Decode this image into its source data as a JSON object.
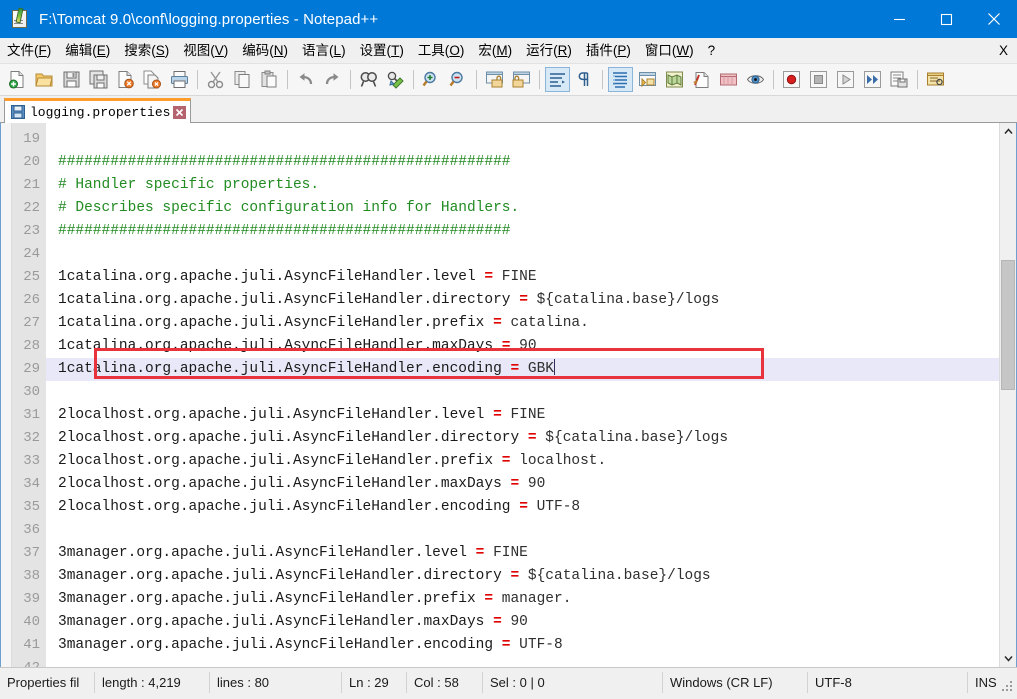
{
  "window": {
    "title": "F:\\Tomcat 9.0\\conf\\logging.properties - Notepad++",
    "icon": "notepad-plus-plus-icon",
    "controls": {
      "minimize": "minimize-icon",
      "maximize": "maximize-icon",
      "close": "close-icon"
    },
    "titlebar_color": "#0078d7"
  },
  "menu": {
    "items": [
      {
        "label": "文件",
        "accel": "F"
      },
      {
        "label": "编辑",
        "accel": "E"
      },
      {
        "label": "搜索",
        "accel": "S"
      },
      {
        "label": "视图",
        "accel": "V"
      },
      {
        "label": "编码",
        "accel": "N"
      },
      {
        "label": "语言",
        "accel": "L"
      },
      {
        "label": "设置",
        "accel": "T"
      },
      {
        "label": "工具",
        "accel": "O"
      },
      {
        "label": "宏",
        "accel": "M"
      },
      {
        "label": "运行",
        "accel": "R"
      },
      {
        "label": "插件",
        "accel": "P"
      },
      {
        "label": "窗口",
        "accel": "W"
      },
      {
        "label": "?",
        "accel": ""
      }
    ],
    "close_document_label": "X"
  },
  "toolbar": {
    "groups": [
      [
        "new-file-icon",
        "open-file-icon",
        "save-icon",
        "save-all-icon",
        "close-file-icon",
        "close-all-files-icon",
        "print-icon"
      ],
      [
        "cut-icon",
        "copy-icon",
        "paste-icon"
      ],
      [
        "undo-icon",
        "redo-icon"
      ],
      [
        "find-icon",
        "replace-icon"
      ],
      [
        "zoom-in-icon",
        "zoom-out-icon"
      ],
      [
        "sync-vertical-scroll-icon",
        "sync-horizontal-scroll-icon"
      ],
      [
        "word-wrap-icon",
        "show-all-characters-icon"
      ],
      [
        "indent-guideline-icon",
        "user-defined-dialog-icon",
        "show-document-map-icon",
        "function-list-icon",
        "folder-as-workspace-icon",
        "monitoring-icon"
      ],
      [
        "macro-record-icon",
        "macro-stop-icon",
        "macro-play-icon",
        "macro-play-multiple-icon",
        "macro-save-icon"
      ],
      [
        "document-list-icon"
      ]
    ],
    "active": [
      "word-wrap-icon",
      "indent-guideline-icon"
    ]
  },
  "tab": {
    "label": "logging.properties",
    "save_icon": "saved-document-icon",
    "close_icon": "tab-close-icon"
  },
  "editor": {
    "first_visible_line": 19,
    "current_line": 29,
    "cursor_after": "GBK",
    "lines": [
      {
        "n": 19,
        "tokens": []
      },
      {
        "n": 20,
        "tokens": [
          {
            "t": "comment",
            "s": "####################################################"
          }
        ]
      },
      {
        "n": 21,
        "tokens": [
          {
            "t": "comment",
            "s": "# Handler specific properties."
          }
        ]
      },
      {
        "n": 22,
        "tokens": [
          {
            "t": "comment",
            "s": "# Describes specific configuration info for Handlers."
          }
        ]
      },
      {
        "n": 23,
        "tokens": [
          {
            "t": "comment",
            "s": "####################################################"
          }
        ]
      },
      {
        "n": 24,
        "tokens": []
      },
      {
        "n": 25,
        "tokens": [
          {
            "t": "key",
            "s": "1catalina.org.apache.juli.AsyncFileHandler.level "
          },
          {
            "t": "eq",
            "s": "="
          },
          {
            "t": "val",
            "s": " FINE"
          }
        ]
      },
      {
        "n": 26,
        "tokens": [
          {
            "t": "key",
            "s": "1catalina.org.apache.juli.AsyncFileHandler.directory "
          },
          {
            "t": "eq",
            "s": "="
          },
          {
            "t": "val",
            "s": " ${catalina.base}/logs"
          }
        ]
      },
      {
        "n": 27,
        "tokens": [
          {
            "t": "key",
            "s": "1catalina.org.apache.juli.AsyncFileHandler.prefix "
          },
          {
            "t": "eq",
            "s": "="
          },
          {
            "t": "val",
            "s": " catalina."
          }
        ]
      },
      {
        "n": 28,
        "tokens": [
          {
            "t": "key",
            "s": "1catalina.org.apache.juli.AsyncFileHandler.maxDays "
          },
          {
            "t": "eq",
            "s": "="
          },
          {
            "t": "val",
            "s": " 90"
          }
        ]
      },
      {
        "n": 29,
        "tokens": [
          {
            "t": "key",
            "s": "1catalina.org.apache.juli.AsyncFileHandler.encoding "
          },
          {
            "t": "eq",
            "s": "="
          },
          {
            "t": "val",
            "s": " GBK"
          }
        ]
      },
      {
        "n": 30,
        "tokens": []
      },
      {
        "n": 31,
        "tokens": [
          {
            "t": "key",
            "s": "2localhost.org.apache.juli.AsyncFileHandler.level "
          },
          {
            "t": "eq",
            "s": "="
          },
          {
            "t": "val",
            "s": " FINE"
          }
        ]
      },
      {
        "n": 32,
        "tokens": [
          {
            "t": "key",
            "s": "2localhost.org.apache.juli.AsyncFileHandler.directory "
          },
          {
            "t": "eq",
            "s": "="
          },
          {
            "t": "val",
            "s": " ${catalina.base}/logs"
          }
        ]
      },
      {
        "n": 33,
        "tokens": [
          {
            "t": "key",
            "s": "2localhost.org.apache.juli.AsyncFileHandler.prefix "
          },
          {
            "t": "eq",
            "s": "="
          },
          {
            "t": "val",
            "s": " localhost."
          }
        ]
      },
      {
        "n": 34,
        "tokens": [
          {
            "t": "key",
            "s": "2localhost.org.apache.juli.AsyncFileHandler.maxDays "
          },
          {
            "t": "eq",
            "s": "="
          },
          {
            "t": "val",
            "s": " 90"
          }
        ]
      },
      {
        "n": 35,
        "tokens": [
          {
            "t": "key",
            "s": "2localhost.org.apache.juli.AsyncFileHandler.encoding "
          },
          {
            "t": "eq",
            "s": "="
          },
          {
            "t": "val",
            "s": " UTF-8"
          }
        ]
      },
      {
        "n": 36,
        "tokens": []
      },
      {
        "n": 37,
        "tokens": [
          {
            "t": "key",
            "s": "3manager.org.apache.juli.AsyncFileHandler.level "
          },
          {
            "t": "eq",
            "s": "="
          },
          {
            "t": "val",
            "s": " FINE"
          }
        ]
      },
      {
        "n": 38,
        "tokens": [
          {
            "t": "key",
            "s": "3manager.org.apache.juli.AsyncFileHandler.directory "
          },
          {
            "t": "eq",
            "s": "="
          },
          {
            "t": "val",
            "s": " ${catalina.base}/logs"
          }
        ]
      },
      {
        "n": 39,
        "tokens": [
          {
            "t": "key",
            "s": "3manager.org.apache.juli.AsyncFileHandler.prefix "
          },
          {
            "t": "eq",
            "s": "="
          },
          {
            "t": "val",
            "s": " manager."
          }
        ]
      },
      {
        "n": 40,
        "tokens": [
          {
            "t": "key",
            "s": "3manager.org.apache.juli.AsyncFileHandler.maxDays "
          },
          {
            "t": "eq",
            "s": "="
          },
          {
            "t": "val",
            "s": " 90"
          }
        ]
      },
      {
        "n": 41,
        "tokens": [
          {
            "t": "key",
            "s": "3manager.org.apache.juli.AsyncFileHandler.encoding "
          },
          {
            "t": "eq",
            "s": "="
          },
          {
            "t": "val",
            "s": " UTF-8"
          }
        ]
      },
      {
        "n": 42,
        "tokens": []
      }
    ],
    "annotation": {
      "type": "red-rectangle-highlight",
      "target_line": 29,
      "color": "#e8323c"
    },
    "colors": {
      "comment": "#228b22",
      "equals": "#e10000",
      "text": "#1a1a1a",
      "current_line_bg": "#e8e8f8",
      "line_number": "#9a9a9a"
    }
  },
  "status": {
    "doc_type": "Properties fil",
    "length": "length : 4,219",
    "lines": "lines : 80",
    "ln": "Ln : 29",
    "col": "Col : 58",
    "sel": "Sel : 0 | 0",
    "eol": "Windows (CR LF)",
    "encoding": "UTF-8",
    "mode": "INS"
  }
}
